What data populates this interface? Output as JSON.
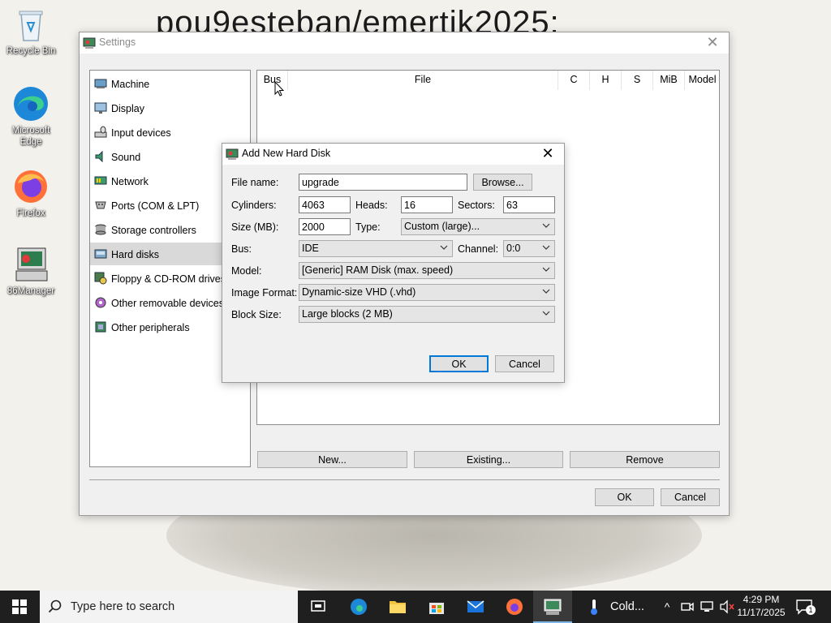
{
  "desktop": {
    "wallpaper_text": "pou9esteban/emertik2025:",
    "icons": [
      {
        "label": "Recycle Bin"
      },
      {
        "label": "Microsoft Edge"
      },
      {
        "label": "Firefox"
      },
      {
        "label": "86Manager"
      }
    ]
  },
  "settings_window": {
    "title": "Settings",
    "categories": [
      {
        "label": "Machine",
        "icon": "machine-icon"
      },
      {
        "label": "Display",
        "icon": "display-icon"
      },
      {
        "label": "Input devices",
        "icon": "input-devices-icon"
      },
      {
        "label": "Sound",
        "icon": "sound-icon"
      },
      {
        "label": "Network",
        "icon": "network-icon"
      },
      {
        "label": "Ports (COM & LPT)",
        "icon": "ports-icon"
      },
      {
        "label": "Storage controllers",
        "icon": "storage-controllers-icon"
      },
      {
        "label": "Hard disks",
        "icon": "hard-disks-icon",
        "selected": true
      },
      {
        "label": "Floppy & CD-ROM drives",
        "icon": "floppy-cdrom-icon"
      },
      {
        "label": "Other removable devices",
        "icon": "removable-devices-icon"
      },
      {
        "label": "Other peripherals",
        "icon": "peripherals-icon"
      }
    ],
    "disk_table": {
      "columns": [
        "Bus",
        "File",
        "C",
        "H",
        "S",
        "MiB",
        "Model"
      ],
      "rows": []
    },
    "buttons": {
      "new": "New...",
      "existing": "Existing...",
      "remove": "Remove",
      "ok": "OK",
      "cancel": "Cancel"
    }
  },
  "add_disk_dialog": {
    "title": "Add New Hard Disk",
    "labels": {
      "file_name": "File name:",
      "cylinders": "Cylinders:",
      "heads": "Heads:",
      "sectors": "Sectors:",
      "size": "Size (MB):",
      "type": "Type:",
      "bus": "Bus:",
      "channel": "Channel:",
      "model": "Model:",
      "image_format": "Image Format:",
      "block_size": "Block Size:"
    },
    "values": {
      "file_name": "upgrade",
      "cylinders": "4063",
      "heads": "16",
      "sectors": "63",
      "size": "2000",
      "type": "Custom (large)...",
      "bus": "IDE",
      "channel": "0:0",
      "model": "[Generic] RAM Disk (max. speed)",
      "image_format": "Dynamic-size VHD (.vhd)",
      "block_size": "Large blocks (2 MB)"
    },
    "buttons": {
      "browse": "Browse...",
      "ok": "OK",
      "cancel": "Cancel"
    }
  },
  "taskbar": {
    "search_placeholder": "Type here to search",
    "weather_text": "Cold...",
    "time": "4:29 PM",
    "date": "11/17/2025",
    "notification_count": "1"
  }
}
